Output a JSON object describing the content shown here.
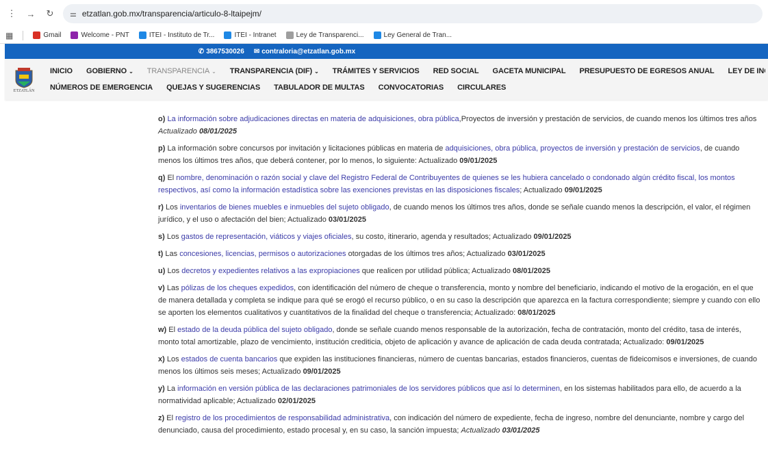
{
  "browser": {
    "url": "etzatlan.gob.mx/transparencia/articulo-8-ltaipejm/",
    "bookmarks": [
      {
        "label": "Gmail",
        "color": "#d93025"
      },
      {
        "label": "Welcome - PNT",
        "color": "#8e24aa"
      },
      {
        "label": "ITEI - Instituto de Tr...",
        "color": "#1e88e5"
      },
      {
        "label": "ITEI - Intranet",
        "color": "#1e88e5"
      },
      {
        "label": "Ley de Transparenci...",
        "color": "#9e9e9e"
      },
      {
        "label": "Ley General de Tran...",
        "color": "#1e88e5"
      }
    ]
  },
  "topbar": {
    "phone": "3867530026",
    "email": "contraloria@etzatlan.gob.mx",
    "color": "#1565c0"
  },
  "logo_text": "ETZATLÁN",
  "nav": {
    "row1": [
      {
        "label": "INICIO",
        "dropdown": false,
        "muted": false
      },
      {
        "label": "GOBIERNO",
        "dropdown": true,
        "muted": false
      },
      {
        "label": "TRANSPARENCIA",
        "dropdown": true,
        "muted": true
      },
      {
        "label": "TRANSPARENCIA (DIF)",
        "dropdown": true,
        "muted": false
      },
      {
        "label": "TRÁMITES Y SERVICIOS",
        "dropdown": false,
        "muted": false
      },
      {
        "label": "RED SOCIAL",
        "dropdown": false,
        "muted": false
      },
      {
        "label": "GACETA MUNICIPAL",
        "dropdown": false,
        "muted": false
      },
      {
        "label": "PRESUPUESTO DE EGRESOS ANUAL",
        "dropdown": false,
        "muted": false
      },
      {
        "label": "LEY DE INGRESOS MUNIC",
        "dropdown": false,
        "muted": false
      }
    ],
    "row2": [
      {
        "label": "NÚMEROS DE EMERGENCIA"
      },
      {
        "label": "QUEJAS Y SUGERENCIAS"
      },
      {
        "label": "TABULADOR DE MULTAS"
      },
      {
        "label": "CONVOCATORIAS"
      },
      {
        "label": "CIRCULARES"
      }
    ]
  },
  "items": [
    {
      "letter": "o)",
      "pre": " ",
      "link": "La información sobre adjudicaciones directas en materia de adquisiciones, obra pública",
      "post": ",Proyectos de inversión y prestación de servicios, de cuando menos los últimos tres años ",
      "upd_label": "Actualizado ",
      "upd_label_italic": true,
      "date": "08/01/2025",
      "date_italic": true
    },
    {
      "letter": "p)",
      "pre": " La información sobre concursos por invitación y licitaciones públicas en materia de ",
      "link": "adquisiciones, obra pública, proyectos de inversión y prestación de servicios",
      "post": ", de cuando menos los últimos tres años, que deberá contener, por lo menos, lo siguiente: ",
      "upd_label": "Actualizado ",
      "upd_label_italic": false,
      "date": "09/01/2025",
      "date_italic": false
    },
    {
      "letter": "q)",
      "pre": " El ",
      "link": "nombre, denominación o razón social y clave del Registro Federal de Contribuyentes de quienes se les hubiera cancelado o condonado algún crédito fiscal, los montos respectivos, así como la información estadística sobre las exenciones previstas en las disposiciones fiscales",
      "post": "; ",
      "upd_label": "Actualizado ",
      "upd_label_italic": false,
      "date": "09/01/2025",
      "date_italic": false
    },
    {
      "letter": "r)",
      "pre": " Los ",
      "link": "inventarios de bienes muebles e inmuebles del sujeto obligado",
      "post": ", de cuando menos los últimos tres años, donde se señale cuando menos la descripción, el valor, el régimen jurídico, y el uso o afectación del bien; ",
      "upd_label": "Actualizado  ",
      "upd_label_italic": false,
      "date": "03/01/2025",
      "date_italic": false
    },
    {
      "letter": "s)",
      "pre": " Los ",
      "link": "gastos de representación, viáticos y viajes oficiales",
      "post": ", su costo, itinerario, agenda y resultados; ",
      "upd_label": "Actualizado ",
      "upd_label_italic": false,
      "date": "09/01/2025",
      "date_italic": false
    },
    {
      "letter": "t)",
      "pre": " Las ",
      "link": "concesiones, licencias, permisos o autorizaciones",
      "post": " otorgadas de los últimos tres años; ",
      "upd_label": "Actualizado ",
      "upd_label_italic": false,
      "date": "03/01/2025",
      "date_italic": false
    },
    {
      "letter": "u)",
      "pre": " Los ",
      "link": "decretos y expedientes relativos a las expropiaciones",
      "post": " que realicen por utilidad pública; ",
      "upd_label": "Actualizado ",
      "upd_label_italic": false,
      "date": "08/01/2025",
      "date_italic": false
    },
    {
      "letter": "v)",
      "pre": " Las ",
      "link": "pólizas de los cheques expedidos",
      "post": ", con identificación del número de cheque o transferencia, monto y nombre del beneficiario, indicando el motivo de la erogación, en el que de manera detallada y completa se indique para qué se erogó el recurso público, o en su caso la descripción que aparezca en la factura correspondiente; siempre y cuando con ello se aporten los elementos cualitativos y cuantitativos de la finalidad del cheque o transferencia; ",
      "upd_label": "Actualizado: ",
      "upd_label_italic": false,
      "date": "08/01/2025",
      "date_italic": false
    },
    {
      "letter": "w)",
      "pre": " El ",
      "link": "estado de la deuda pública del sujeto obligado",
      "post": ", donde se señale cuando menos responsable de la autorización, fecha de contratación, monto del crédito, tasa de interés, monto total amortizable, plazo de vencimiento, institución crediticia, objeto de aplicación y avance de aplicación de cada deuda contratada; ",
      "upd_label": "Actualizado: ",
      "upd_label_italic": false,
      "date": "09/01/2025",
      "date_italic": false
    },
    {
      "letter": "x)",
      "pre": " Los ",
      "link": "estados de cuenta bancarios",
      "post": " que expiden las instituciones financieras, número de cuentas bancarias, estados financieros, cuentas de fideicomisos e inversiones, de cuando menos los últimos seis meses; ",
      "upd_label": "Actualizado ",
      "upd_label_italic": false,
      "date": "09/01/2025",
      "date_italic": false
    },
    {
      "letter": "y)",
      "pre": " La ",
      "link": "información en versión pública de las declaraciones patrimoniales de los servidores públicos que así lo determinen",
      "post": ", en los sistemas habilitados para ello, de acuerdo a la normatividad aplicable; ",
      "upd_label": "Actualizado ",
      "upd_label_italic": false,
      "date": "02/01/2025",
      "date_italic": false
    },
    {
      "letter": "z)",
      "pre": " El ",
      "link": "registro de los procedimientos de responsabilidad administrativa",
      "post": ", con indicación del número de expediente, fecha de ingreso, nombre del denunciante, nombre y cargo del denunciado, causa del procedimiento, estado procesal y, en su caso, la sanción impuesta; ",
      "upd_label": "Actualizado ",
      "upd_label_italic": true,
      "date": "03/01/2025",
      "date_italic": true
    }
  ]
}
